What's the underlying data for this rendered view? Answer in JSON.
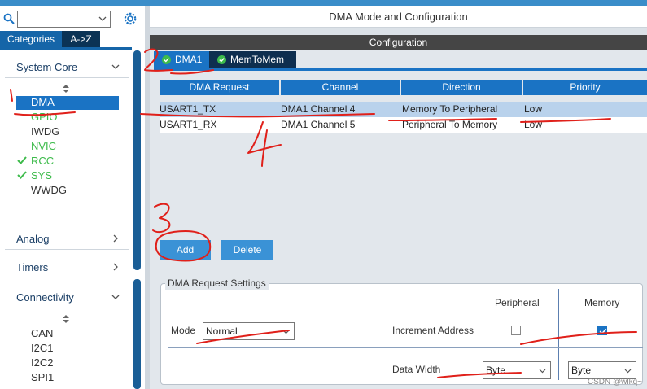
{
  "window": {
    "mode_title": "DMA Mode and Configuration",
    "config_header": "Configuration"
  },
  "search": {
    "value": "",
    "placeholder": ""
  },
  "category_tabs": [
    "Categories",
    "A->Z"
  ],
  "sections": {
    "system_core": "System Core",
    "analog": "Analog",
    "timers": "Timers",
    "connectivity": "Connectivity"
  },
  "system_core_items": [
    "DMA",
    "GPIO",
    "IWDG",
    "NVIC",
    "RCC",
    "SYS",
    "WWDG"
  ],
  "connectivity_items": [
    "CAN",
    "I2C1",
    "I2C2",
    "SPI1"
  ],
  "config_tabs": [
    "DMA1",
    "MemToMem"
  ],
  "table": {
    "headers": [
      "DMA Request",
      "Channel",
      "Direction",
      "Priority"
    ],
    "rows": [
      [
        "USART1_TX",
        "DMA1 Channel 4",
        "Memory To Peripheral",
        "Low"
      ],
      [
        "USART1_RX",
        "DMA1 Channel 5",
        "Peripheral To Memory",
        "Low"
      ]
    ]
  },
  "buttons": {
    "add": "Add",
    "delete": "Delete"
  },
  "settings": {
    "legend": "DMA Request Settings",
    "col_peripheral": "Peripheral",
    "col_memory": "Memory",
    "mode_label": "Mode",
    "mode_value": "Normal",
    "increment_label": "Increment Address",
    "peripheral_increment": false,
    "memory_increment": true,
    "data_width_label": "Data Width",
    "peripheral_width": "Byte",
    "memory_width": "Byte"
  },
  "annotations": [
    "1",
    "2",
    "3",
    "4"
  ],
  "watermark": "CSDN @wlkq~",
  "colors": {
    "accent": "#1a73c4",
    "dark_tab": "#0e2e4f",
    "header": "#454545",
    "green": "#3dbb4b",
    "annotation": "#e0201a"
  }
}
